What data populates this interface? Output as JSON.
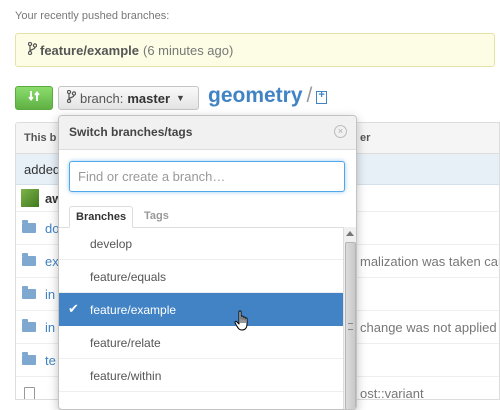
{
  "recent": {
    "heading": "Your recently pushed branches:",
    "branch_name": "feature/example",
    "time": "(6 minutes ago)"
  },
  "toolbar": {
    "branch_label": "branch:",
    "branch_value": "master",
    "repo_name": "geometry",
    "separator": "/"
  },
  "background_table": {
    "header_left": "This b",
    "header_right": "er",
    "commit_message": "added",
    "author": "aw",
    "files": [
      {
        "name": "do",
        "message": ""
      },
      {
        "name": "ex",
        "message": "malization was taken care"
      },
      {
        "name": "in",
        "message": ""
      },
      {
        "name": "in",
        "message": "change was not applied b"
      },
      {
        "name": "te",
        "message": ""
      },
      {
        "name": "",
        "message": "ost::variant"
      }
    ]
  },
  "dropdown": {
    "title": "Switch branches/tags",
    "close_icon": "×",
    "filter_placeholder": "Find or create a branch…",
    "tabs": [
      {
        "label": "Branches"
      },
      {
        "label": "Tags"
      }
    ],
    "items": [
      {
        "label": "develop"
      },
      {
        "label": "feature/equals"
      },
      {
        "label": "feature/example"
      },
      {
        "label": "feature/relate"
      },
      {
        "label": "feature/within"
      }
    ],
    "selected_item": "feature/example"
  },
  "colors": {
    "accent": "#4183c4",
    "compare_green": "#60b044",
    "recent_bg": "#fdfde5"
  }
}
